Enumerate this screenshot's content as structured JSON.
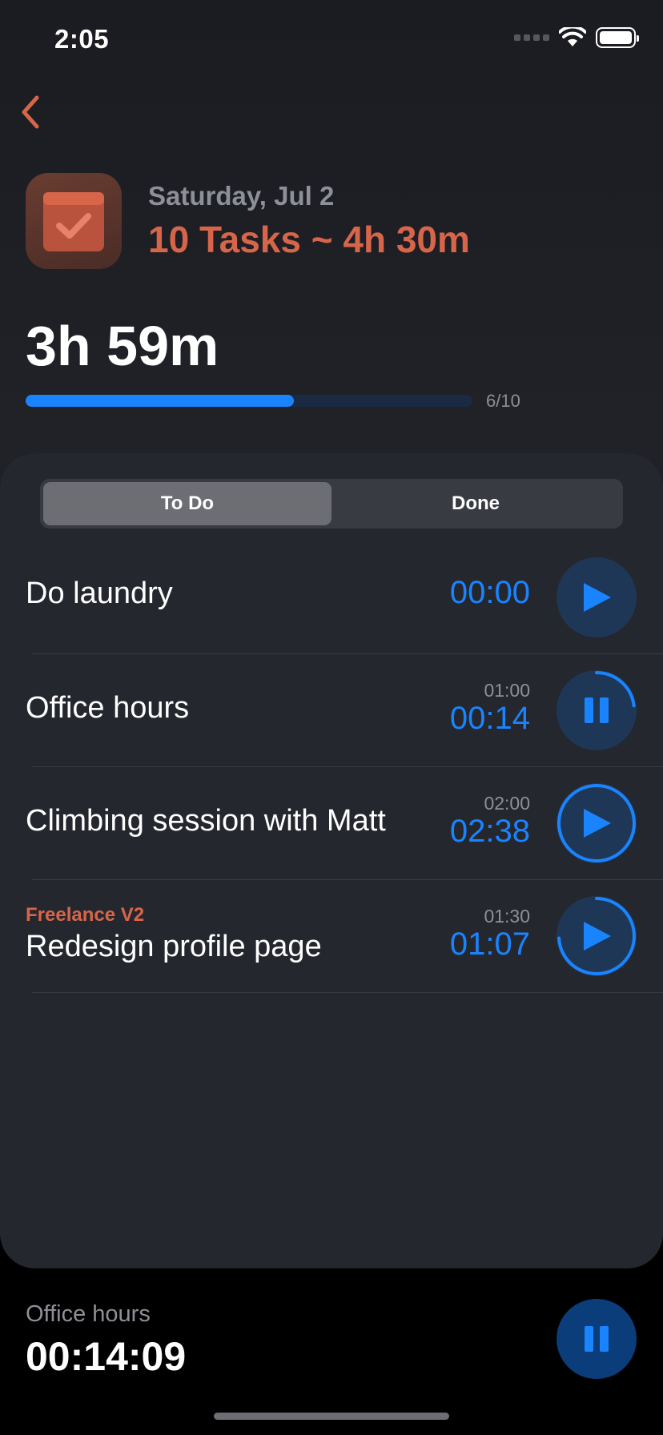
{
  "status_bar": {
    "time": "2:05"
  },
  "header": {
    "date": "Saturday, Jul 2",
    "summary": "10 Tasks ~ 4h 30m",
    "total_time": "3h 59m",
    "progress_count": "6/10",
    "progress_fraction": 0.6
  },
  "tabs": [
    {
      "label": "To Do",
      "active": true
    },
    {
      "label": "Done",
      "active": false
    }
  ],
  "tasks": [
    {
      "name": "Do laundry",
      "project": "",
      "target": "",
      "elapsed": "00:00",
      "state": "play",
      "progress": 0
    },
    {
      "name": "Office hours",
      "project": "",
      "target": "01:00",
      "elapsed": "00:14",
      "state": "pause",
      "progress": 0.23
    },
    {
      "name": "Climbing session with Matt",
      "project": "",
      "target": "02:00",
      "elapsed": "02:38",
      "state": "play",
      "progress": 1
    },
    {
      "name": "Redesign profile page",
      "project": "Freelance V2",
      "target": "01:30",
      "elapsed": "01:07",
      "state": "play",
      "progress": 0.74
    }
  ],
  "active_timer": {
    "label": "Office hours",
    "time": "00:14:09"
  },
  "colors": {
    "accent_blue": "#1a84ff",
    "accent_orange": "#d7654a"
  }
}
